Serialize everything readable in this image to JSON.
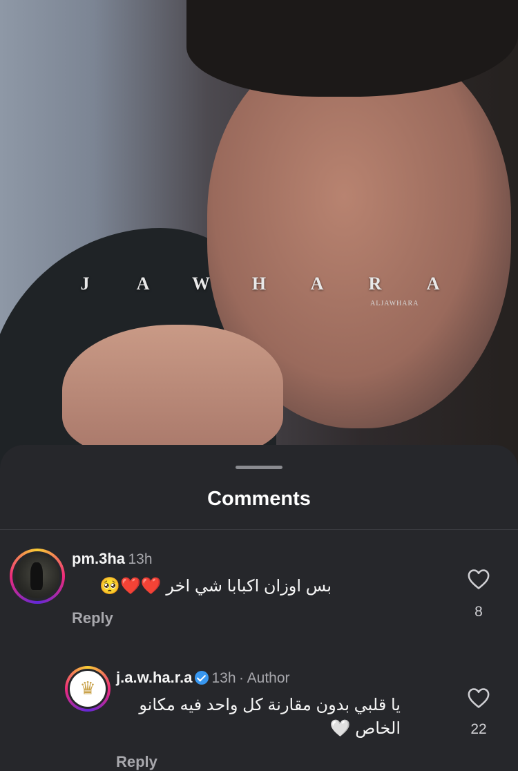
{
  "video": {
    "watermark_letters": [
      "J",
      "A",
      "W",
      "H",
      "A",
      "R",
      "A"
    ],
    "watermark_sub": "ALJAWHARA"
  },
  "sheet": {
    "title": "Comments"
  },
  "comments": [
    {
      "username": "pm.3ha",
      "time": "13h",
      "text": "بس اوزان اكبابا شي اخر ❤️❤️🥺",
      "reply_label": "Reply",
      "like_count": "8"
    },
    {
      "username": "j.a.w.ha.r.a",
      "verified": true,
      "time": "13h",
      "author_label": "· Author",
      "text_line1": "يا قلبي بدون مقارنة كل واحد فيه مكانو",
      "text_line2": "الخاص 🤍",
      "reply_label": "Reply",
      "like_count": "22"
    }
  ],
  "icons": {
    "like": "heart-outline-icon",
    "verified": "verified-badge-icon"
  },
  "colors": {
    "sheet_bg": "#26272b",
    "verified_blue": "#3897f0",
    "muted_text": "#a8a8ad"
  }
}
